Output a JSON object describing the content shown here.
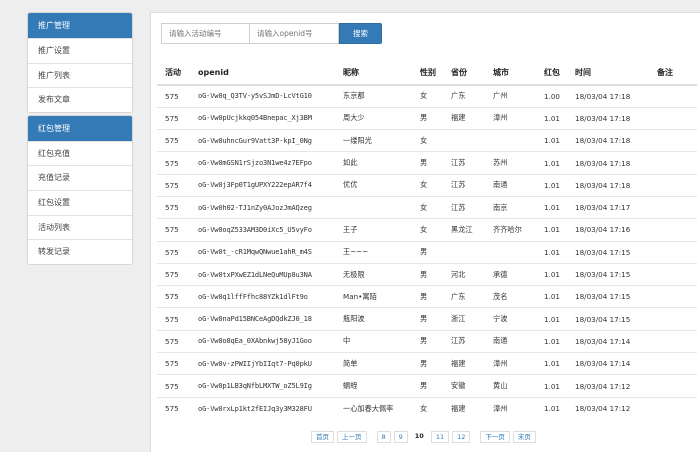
{
  "sidebar": {
    "groups": [
      {
        "head": "推广管理",
        "items": [
          "推广设置",
          "推广列表",
          "发布文章"
        ]
      },
      {
        "head": "红包管理",
        "items": [
          "红包充值",
          "充值记录",
          "红包设置",
          "活动列表",
          "转发记录"
        ]
      }
    ]
  },
  "search": {
    "activity_placeholder": "请输入活动编号",
    "openid_placeholder": "请输入openid号",
    "button_label": "搜索"
  },
  "table": {
    "headers": [
      "活动",
      "openid",
      "昵称",
      "性别",
      "省份",
      "城市",
      "红包",
      "时间",
      "备注"
    ],
    "rows": [
      [
        "575",
        "oG-Vw0q_Q3TV-y5vSJmD-LcVtG10",
        "东京都",
        "女",
        "广东",
        "广州",
        "1.00",
        "18/03/04 17:18",
        ""
      ],
      [
        "575",
        "oG-Vw0pUcjkkq054Bnepac_Xj3BM",
        "周大少",
        "男",
        "福建",
        "漳州",
        "1.01",
        "18/03/04 17:18",
        ""
      ],
      [
        "575",
        "oG-Vw0uhncGur9Vatt3P-kpI_0Ng",
        "一缕阳光",
        "女",
        "",
        "",
        "1.01",
        "18/03/04 17:18",
        ""
      ],
      [
        "575",
        "oG-Vw0mGSN1rSjzo3N1we4z7EFpo",
        "如此",
        "男",
        "江苏",
        "苏州",
        "1.01",
        "18/03/04 17:18",
        ""
      ],
      [
        "575",
        "oG-Vw0j3Fp0T1gUPXY222epAR7f4",
        "优优",
        "女",
        "江苏",
        "南通",
        "1.01",
        "18/03/04 17:18",
        ""
      ],
      [
        "575",
        "oG-Vw0h02-TJ1nZy0AJozJmAQzeg",
        "",
        "女",
        "江苏",
        "南京",
        "1.01",
        "18/03/04 17:17",
        ""
      ],
      [
        "575",
        "oG-Vw0oqZ533AM3D0iXc5_U5vyFo",
        "王子",
        "女",
        "黑龙江",
        "齐齐哈尔",
        "1.01",
        "18/03/04 17:16",
        ""
      ],
      [
        "575",
        "oG-Vw0t_-cR1MqwQNwue1ahR_m4S",
        "王~~~",
        "男",
        "",
        "",
        "1.01",
        "18/03/04 17:15",
        ""
      ],
      [
        "575",
        "oG-Vw0txPXwEZ1dLNeQuMUp8u3NA",
        "无极限",
        "男",
        "河北",
        "承德",
        "1.01",
        "18/03/04 17:15",
        ""
      ],
      [
        "575",
        "oG-Vw0q1lffFfhc88YZk1dlFt9o",
        "Man•寓陌",
        "男",
        "广东",
        "茂名",
        "1.01",
        "18/03/04 17:15",
        ""
      ],
      [
        "575",
        "oG-Vw0naPd15BNCeAgDQdkZJ0_18",
        "瓶阳波",
        "男",
        "浙江",
        "宁波",
        "1.01",
        "18/03/04 17:15",
        ""
      ],
      [
        "575",
        "oG-Vw0o8qEa_0XAbnkwj58yJ1Goo",
        "中",
        "男",
        "江苏",
        "南通",
        "1.01",
        "18/03/04 17:14",
        ""
      ],
      [
        "575",
        "oG-Vw0v-zPWIIjYbIIqt7-Pq0pkU",
        "简单",
        "男",
        "福建",
        "漳州",
        "1.01",
        "18/03/04 17:14",
        ""
      ],
      [
        "575",
        "oG-Vw0p1LB3qNfbLMXTW_oZ5L9Ig",
        "蜗蛭",
        "男",
        "安徽",
        "黄山",
        "1.01",
        "18/03/04 17:12",
        ""
      ],
      [
        "575",
        "oG-Vw0rxLp1kt2fEIJq3y3M328FU",
        "一心加春大佩率",
        "女",
        "福建",
        "漳州",
        "1.01",
        "18/03/04 17:12",
        ""
      ]
    ]
  },
  "pagination": {
    "first": "首页",
    "prev": "上一页",
    "pages": [
      "8",
      "9",
      "10",
      "11",
      "12"
    ],
    "current": "10",
    "next": "下一页",
    "last": "末页"
  },
  "colors": {
    "accent": "#337ab7",
    "page_bg": "#eeeeee"
  }
}
